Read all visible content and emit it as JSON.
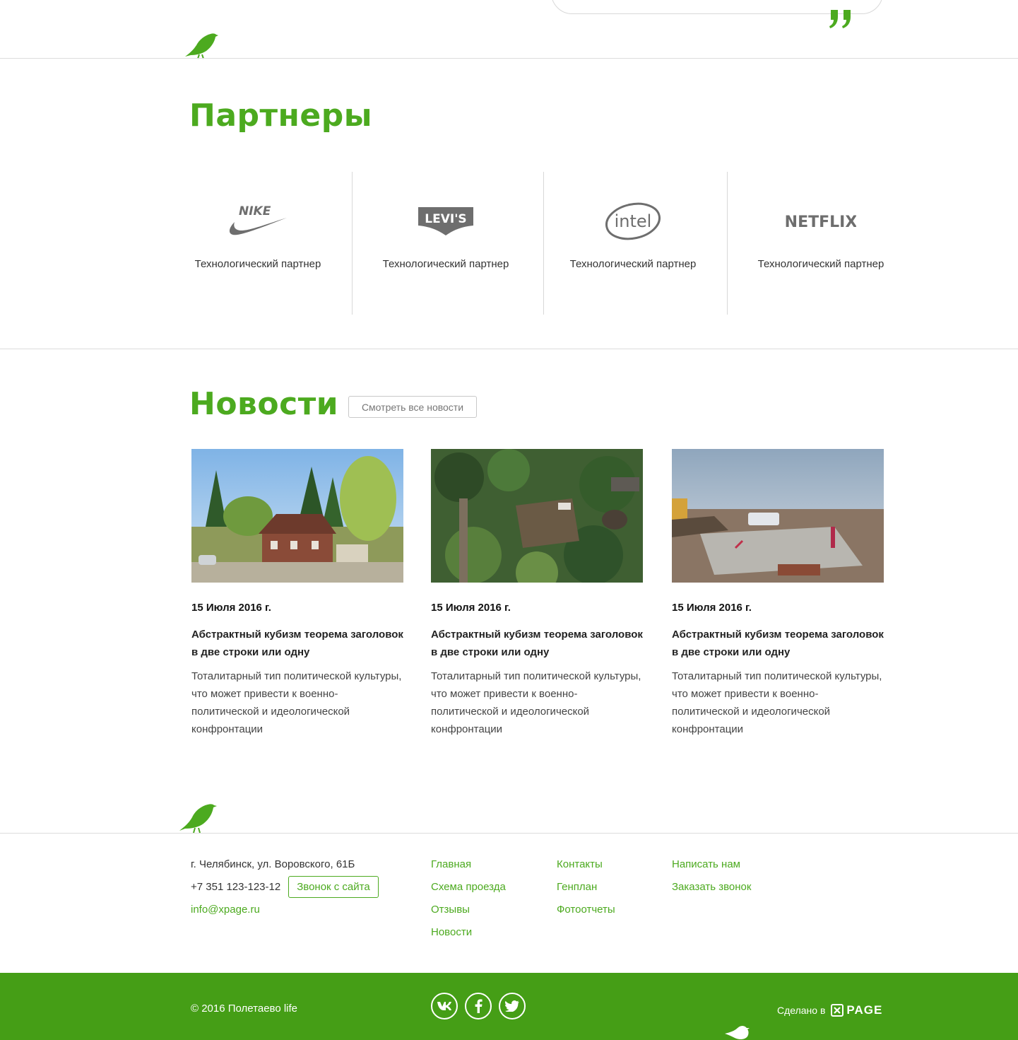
{
  "partners": {
    "title": "Партнеры",
    "items": [
      {
        "brand": "NIKE",
        "caption": "Технологический партнер"
      },
      {
        "brand": "LEVI'S",
        "caption": "Технологический партнер"
      },
      {
        "brand": "intel",
        "caption": "Технологический партнер"
      },
      {
        "brand": "NETFLIX",
        "caption": "Технологический партнер"
      }
    ]
  },
  "news": {
    "title": "Новости",
    "all_button": "Смотреть все новости",
    "items": [
      {
        "date": "15 Июля 2016 г.",
        "headline": "Абстрактный кубизм теорема заголовок в две строки или одну",
        "excerpt": "Тоталитарный тип политической культуры, что может привести к военно-политической и идеологической конфронтации"
      },
      {
        "date": "15 Июля 2016 г.",
        "headline": "Абстрактный кубизм теорема заголовок в две строки или одну",
        "excerpt": "Тоталитарный тип политической культуры, что может привести к военно-политической и идеологической конфронтации"
      },
      {
        "date": "15 Июля 2016 г.",
        "headline": "Абстрактный кубизм теорема заголовок в две строки или одну",
        "excerpt": "Тоталитарный тип политической культуры, что может привести к военно-политической и идеологической конфронтации"
      }
    ]
  },
  "footer": {
    "address": "г. Челябинск, ул. Воровского, 61Б",
    "phone": "+7 351 123-123-12",
    "call_button": "Звонок с сайта",
    "email": "info@xpage.ru",
    "nav_col1": [
      "Главная",
      "Схема проезда",
      "Отзывы",
      "Новости"
    ],
    "nav_col2": [
      "Контакты",
      "Генплан",
      "Фотоотчеты"
    ],
    "nav_col3": [
      "Написать нам",
      "Заказать звонок"
    ],
    "copyright": "© 2016 Полетаево life",
    "social": [
      "vk",
      "f",
      "twitter"
    ],
    "made_in": "Сделано в",
    "xpage": "PAGE"
  },
  "colors": {
    "accent": "#4caa1f",
    "bottom_bar": "#459e16"
  }
}
